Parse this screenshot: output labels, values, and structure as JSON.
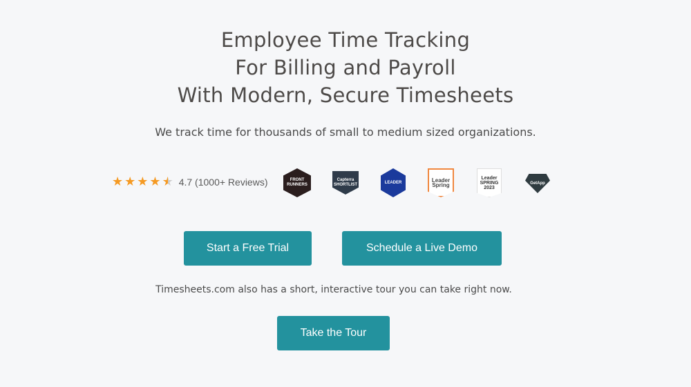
{
  "hero": {
    "title_lines": [
      "Employee Time Tracking",
      "For Billing and Payroll",
      "With Modern, Secure Timesheets"
    ],
    "subtitle": "We track time for thousands of small to medium sized organizations."
  },
  "rating": {
    "value": 4.7,
    "text": "4.7 (1000+ Reviews)",
    "stars": 4.5,
    "star_color": "#f59a23"
  },
  "badges": [
    {
      "name": "software-advice-front-runners",
      "label": "FRONT RUNNERS",
      "color": "#2b1e1e"
    },
    {
      "name": "capterra-shortlist",
      "label": "Capterra SHORTLIST",
      "color": "#2f3b4a"
    },
    {
      "name": "leader-badge",
      "label": "LEADER",
      "color": "#1b3a9c"
    },
    {
      "name": "sourceforge-leader-spring",
      "label": "Leader Spring",
      "color": "#f0873f"
    },
    {
      "name": "g2-leader-spring-2023",
      "label": "Leader SPRING 2023",
      "color": "#e8463a"
    },
    {
      "name": "getapp-category-leaders",
      "label": "GetApp",
      "color": "#2f3b40"
    }
  ],
  "buttons": {
    "trial": "Start a Free Trial",
    "demo": "Schedule a Live Demo",
    "tour": "Take the Tour"
  },
  "tour_note": "Timesheets.com also has a short, interactive tour you can take right now.",
  "colors": {
    "accent": "#23929e",
    "background": "#f6f7f9"
  }
}
